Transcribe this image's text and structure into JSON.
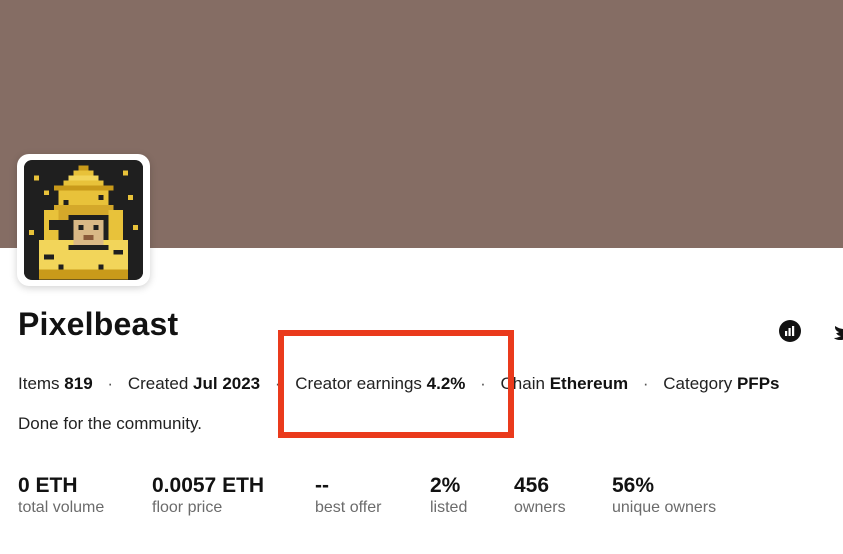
{
  "collection": {
    "name": "Pixelbeast",
    "description": "Done for the community."
  },
  "meta": {
    "items_label": "Items",
    "items_value": "819",
    "created_label": "Created",
    "created_value": "Jul 2023",
    "earnings_label": "Creator earnings",
    "earnings_value": "4.2%",
    "chain_label": "Chain",
    "chain_value": "Ethereum",
    "category_label": "Category",
    "category_value": "PFPs",
    "separator": "·"
  },
  "stats": [
    {
      "value": "0 ETH",
      "label": "total volume"
    },
    {
      "value": "0.0057 ETH",
      "label": "floor price"
    },
    {
      "value": "--",
      "label": "best offer"
    },
    {
      "value": "2%",
      "label": "listed"
    },
    {
      "value": "456",
      "label": "owners"
    },
    {
      "value": "56%",
      "label": "unique owners"
    }
  ],
  "icons": {
    "stats": "stats-chart-icon",
    "twitter": "twitter-icon"
  },
  "colors": {
    "banner": "#856d64",
    "highlight": "#ea3a1c"
  }
}
